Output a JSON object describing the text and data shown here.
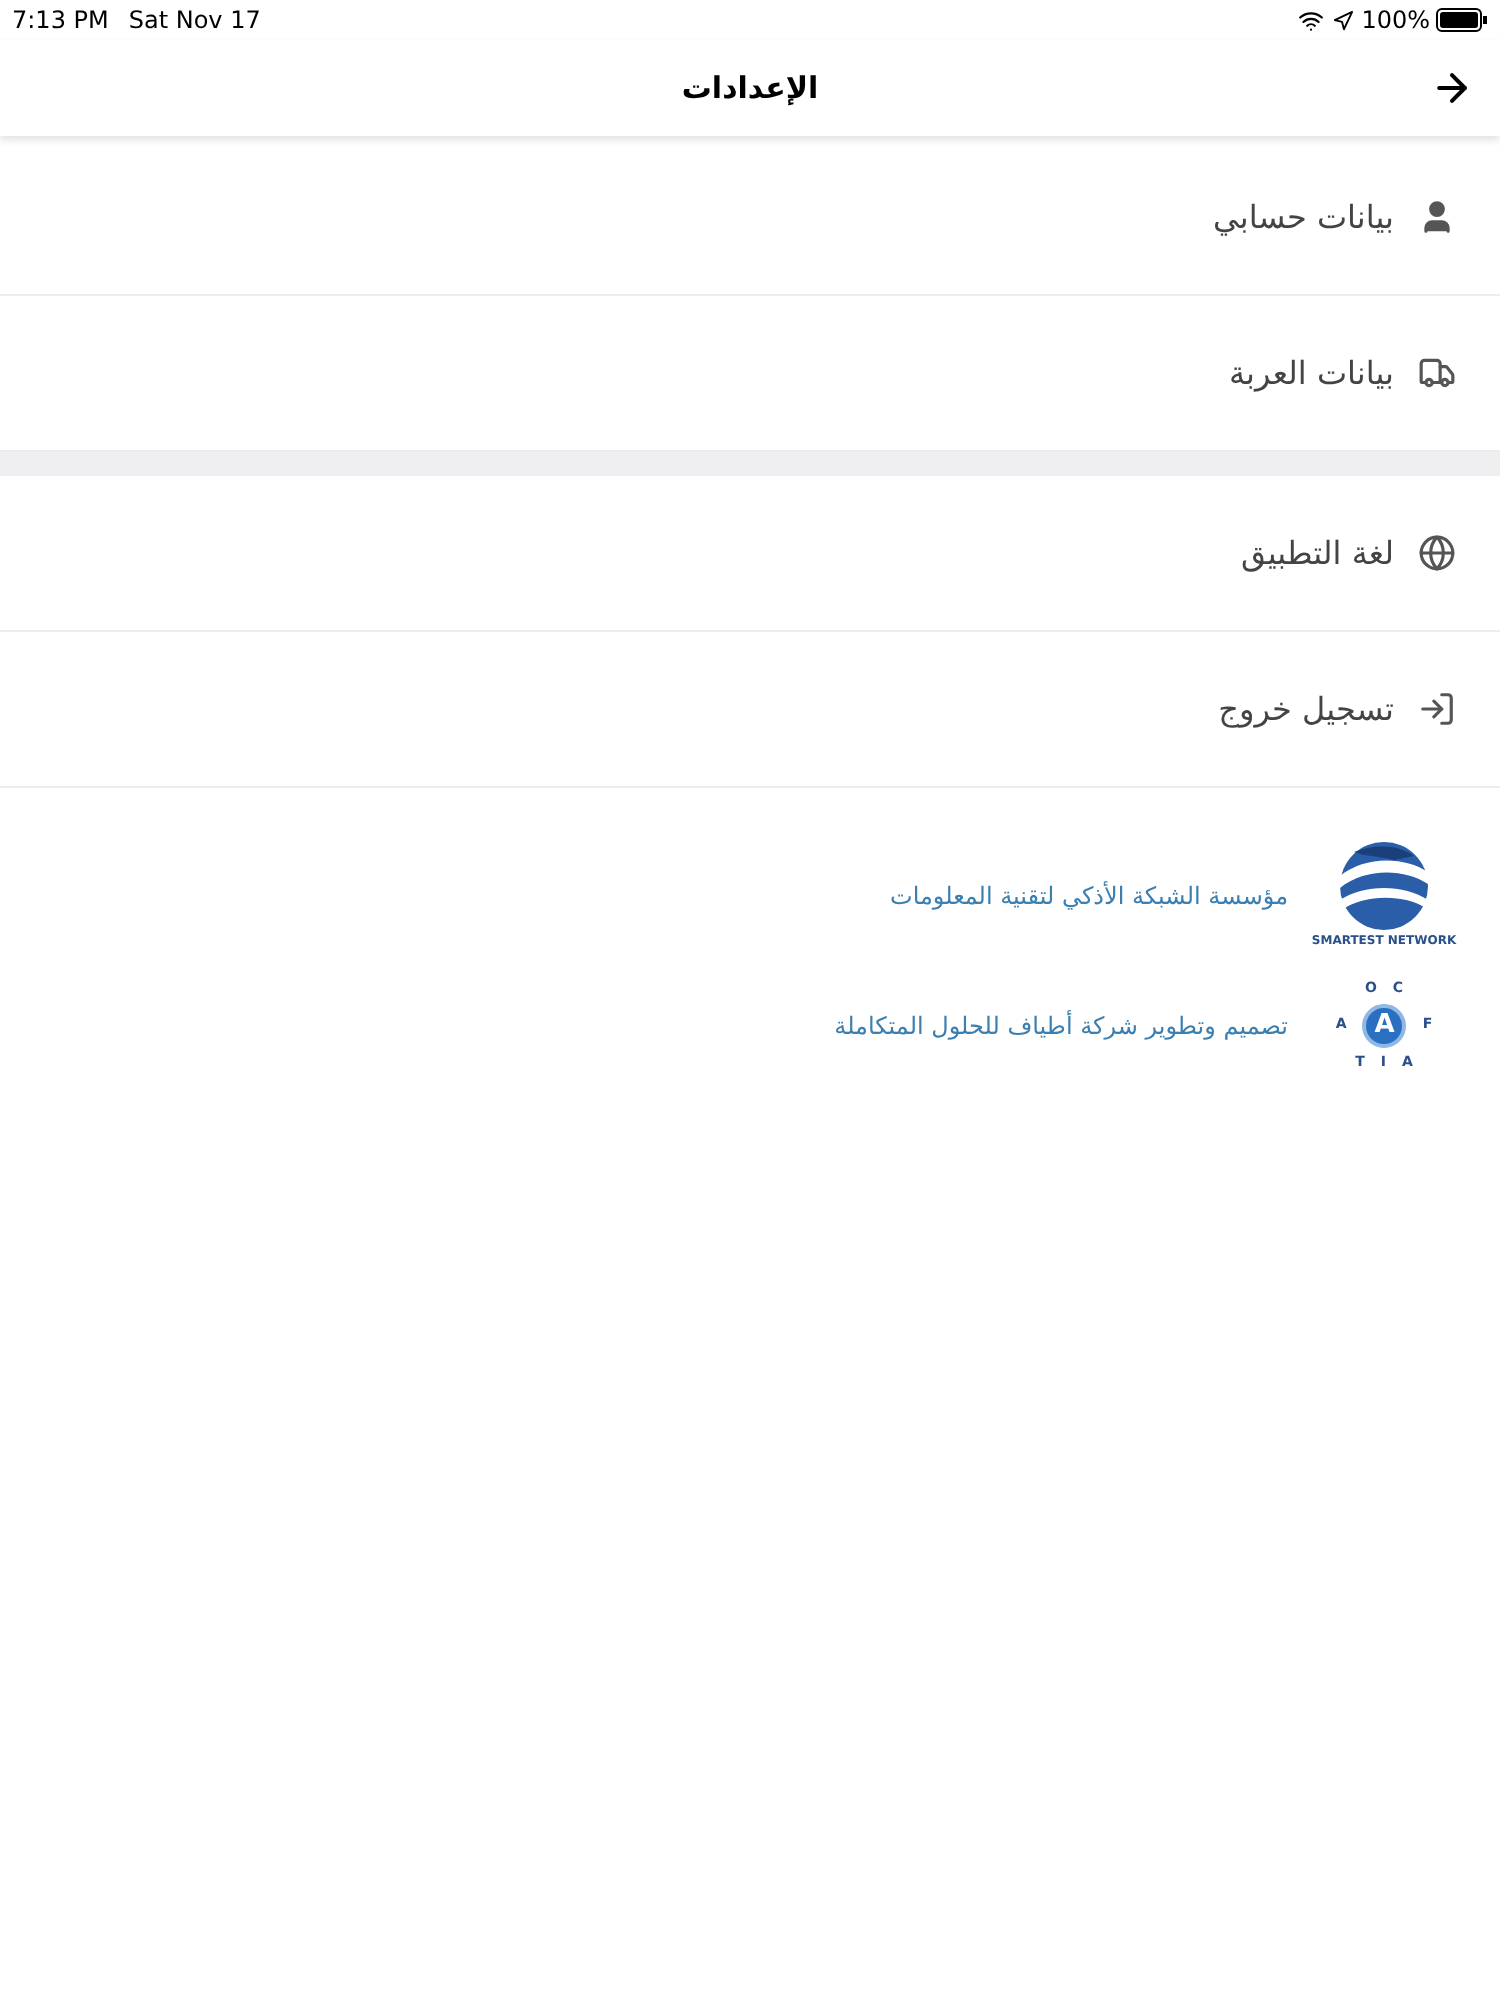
{
  "status_bar": {
    "time": "7:13 PM",
    "date": "Sat Nov 17",
    "battery": "100%"
  },
  "header": {
    "title": "الإعدادات"
  },
  "groups": [
    [
      {
        "label": "بيانات حسابي",
        "kind": "user"
      },
      {
        "label": "بيانات العربة",
        "kind": "truck"
      }
    ],
    [
      {
        "label": "لغة التطبيق",
        "kind": "globe"
      },
      {
        "label": "تسجيل خروج",
        "kind": "logout"
      }
    ]
  ],
  "credits": [
    {
      "text": "مؤسسة الشبكة الأذكي لتقنية المعلومات",
      "kind": "globe",
      "logo_text": "SMARTEST NETWORK"
    },
    {
      "text": "تصميم وتطوير شركة أطياف للحلول المتكاملة",
      "kind": "ring",
      "logo_letters": [
        [
          "C",
          "O"
        ],
        [
          "F",
          "A",
          "A"
        ],
        [
          "A",
          "I",
          "T"
        ]
      ]
    }
  ]
}
